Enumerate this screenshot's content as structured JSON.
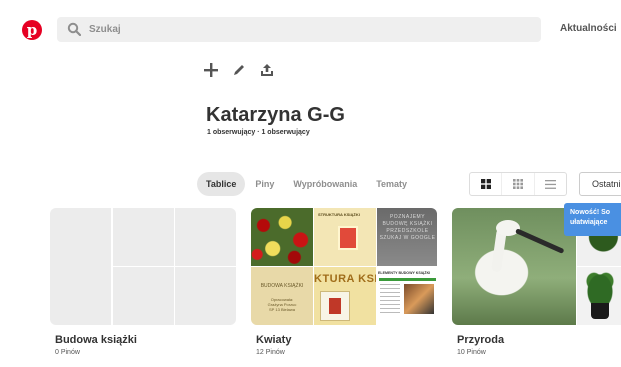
{
  "header": {
    "logo_glyph": "p",
    "search_placeholder": "Szukaj",
    "news_link": "Aktualności"
  },
  "profile": {
    "name": "Katarzyna G-G",
    "followers": "1 obserwujący · 1 obserwujący"
  },
  "tabs": [
    {
      "label": "Tablice",
      "active": true
    },
    {
      "label": "Piny",
      "active": false
    },
    {
      "label": "Wypróbowania",
      "active": false
    },
    {
      "label": "Tematy",
      "active": false
    }
  ],
  "sort_label": "Ostatni",
  "tooltip": {
    "line1": "Nowość! So",
    "line2": "ułatwiające"
  },
  "boards": [
    {
      "title": "Budowa książki",
      "count": "0 Pinów"
    },
    {
      "title": "Kwiaty",
      "count": "12 Pinów",
      "images": {
        "struktura_label": "STRUKTURA KSIĄŻKI",
        "budowa_line1": "BUDOWA KSIĄŻKI",
        "budowa_line2": "Opracowała:",
        "budowa_line3": "Grażyna Porzuc",
        "budowa_line4": "SP 13 Bielawa",
        "ktura_text": "KTURA KSI",
        "poznajemy_text": "POZNAJEMY BUDOWĘ KSIĄŻKI PRZEDSZKOLE SZUKAJ W GOOGLE",
        "elementy_label": "ELEMENTY BUDOWY KSIĄŻKI"
      }
    },
    {
      "title": "Przyroda",
      "count": "10 Pinów"
    }
  ],
  "colors": {
    "brand": "#e60023",
    "tooltip": "#4a90e2",
    "tab_active_bg": "#e6e6e6"
  },
  "icons": {
    "search": "search-icon",
    "add": "plus-icon",
    "edit": "pencil-icon",
    "share": "share-icon",
    "grid_large": "grid-large-icon",
    "grid_small": "grid-small-icon",
    "list": "list-icon"
  }
}
